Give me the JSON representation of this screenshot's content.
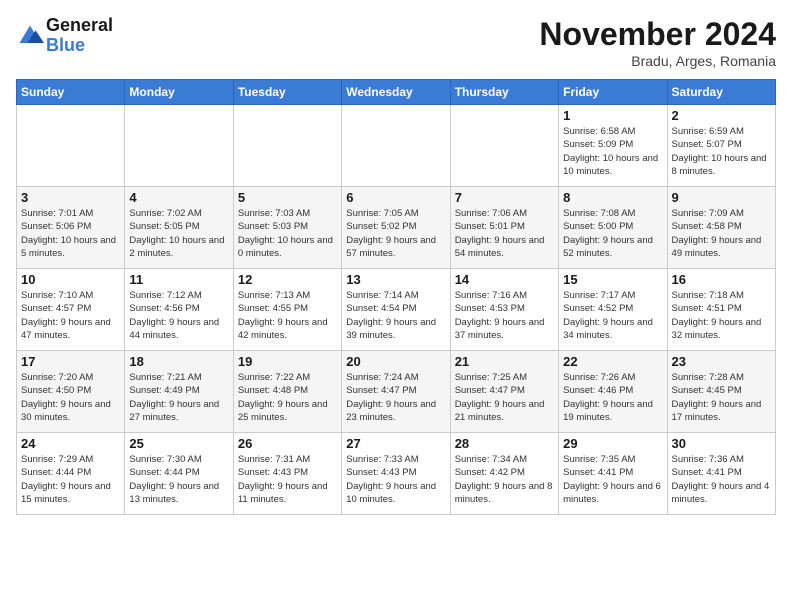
{
  "logo": {
    "text_general": "General",
    "text_blue": "Blue"
  },
  "title": "November 2024",
  "location": "Bradu, Arges, Romania",
  "days_of_week": [
    "Sunday",
    "Monday",
    "Tuesday",
    "Wednesday",
    "Thursday",
    "Friday",
    "Saturday"
  ],
  "weeks": [
    [
      {
        "day": "",
        "info": ""
      },
      {
        "day": "",
        "info": ""
      },
      {
        "day": "",
        "info": ""
      },
      {
        "day": "",
        "info": ""
      },
      {
        "day": "",
        "info": ""
      },
      {
        "day": "1",
        "info": "Sunrise: 6:58 AM\nSunset: 5:09 PM\nDaylight: 10 hours and 10 minutes."
      },
      {
        "day": "2",
        "info": "Sunrise: 6:59 AM\nSunset: 5:07 PM\nDaylight: 10 hours and 8 minutes."
      }
    ],
    [
      {
        "day": "3",
        "info": "Sunrise: 7:01 AM\nSunset: 5:06 PM\nDaylight: 10 hours and 5 minutes."
      },
      {
        "day": "4",
        "info": "Sunrise: 7:02 AM\nSunset: 5:05 PM\nDaylight: 10 hours and 2 minutes."
      },
      {
        "day": "5",
        "info": "Sunrise: 7:03 AM\nSunset: 5:03 PM\nDaylight: 10 hours and 0 minutes."
      },
      {
        "day": "6",
        "info": "Sunrise: 7:05 AM\nSunset: 5:02 PM\nDaylight: 9 hours and 57 minutes."
      },
      {
        "day": "7",
        "info": "Sunrise: 7:06 AM\nSunset: 5:01 PM\nDaylight: 9 hours and 54 minutes."
      },
      {
        "day": "8",
        "info": "Sunrise: 7:08 AM\nSunset: 5:00 PM\nDaylight: 9 hours and 52 minutes."
      },
      {
        "day": "9",
        "info": "Sunrise: 7:09 AM\nSunset: 4:58 PM\nDaylight: 9 hours and 49 minutes."
      }
    ],
    [
      {
        "day": "10",
        "info": "Sunrise: 7:10 AM\nSunset: 4:57 PM\nDaylight: 9 hours and 47 minutes."
      },
      {
        "day": "11",
        "info": "Sunrise: 7:12 AM\nSunset: 4:56 PM\nDaylight: 9 hours and 44 minutes."
      },
      {
        "day": "12",
        "info": "Sunrise: 7:13 AM\nSunset: 4:55 PM\nDaylight: 9 hours and 42 minutes."
      },
      {
        "day": "13",
        "info": "Sunrise: 7:14 AM\nSunset: 4:54 PM\nDaylight: 9 hours and 39 minutes."
      },
      {
        "day": "14",
        "info": "Sunrise: 7:16 AM\nSunset: 4:53 PM\nDaylight: 9 hours and 37 minutes."
      },
      {
        "day": "15",
        "info": "Sunrise: 7:17 AM\nSunset: 4:52 PM\nDaylight: 9 hours and 34 minutes."
      },
      {
        "day": "16",
        "info": "Sunrise: 7:18 AM\nSunset: 4:51 PM\nDaylight: 9 hours and 32 minutes."
      }
    ],
    [
      {
        "day": "17",
        "info": "Sunrise: 7:20 AM\nSunset: 4:50 PM\nDaylight: 9 hours and 30 minutes."
      },
      {
        "day": "18",
        "info": "Sunrise: 7:21 AM\nSunset: 4:49 PM\nDaylight: 9 hours and 27 minutes."
      },
      {
        "day": "19",
        "info": "Sunrise: 7:22 AM\nSunset: 4:48 PM\nDaylight: 9 hours and 25 minutes."
      },
      {
        "day": "20",
        "info": "Sunrise: 7:24 AM\nSunset: 4:47 PM\nDaylight: 9 hours and 23 minutes."
      },
      {
        "day": "21",
        "info": "Sunrise: 7:25 AM\nSunset: 4:47 PM\nDaylight: 9 hours and 21 minutes."
      },
      {
        "day": "22",
        "info": "Sunrise: 7:26 AM\nSunset: 4:46 PM\nDaylight: 9 hours and 19 minutes."
      },
      {
        "day": "23",
        "info": "Sunrise: 7:28 AM\nSunset: 4:45 PM\nDaylight: 9 hours and 17 minutes."
      }
    ],
    [
      {
        "day": "24",
        "info": "Sunrise: 7:29 AM\nSunset: 4:44 PM\nDaylight: 9 hours and 15 minutes."
      },
      {
        "day": "25",
        "info": "Sunrise: 7:30 AM\nSunset: 4:44 PM\nDaylight: 9 hours and 13 minutes."
      },
      {
        "day": "26",
        "info": "Sunrise: 7:31 AM\nSunset: 4:43 PM\nDaylight: 9 hours and 11 minutes."
      },
      {
        "day": "27",
        "info": "Sunrise: 7:33 AM\nSunset: 4:43 PM\nDaylight: 9 hours and 10 minutes."
      },
      {
        "day": "28",
        "info": "Sunrise: 7:34 AM\nSunset: 4:42 PM\nDaylight: 9 hours and 8 minutes."
      },
      {
        "day": "29",
        "info": "Sunrise: 7:35 AM\nSunset: 4:41 PM\nDaylight: 9 hours and 6 minutes."
      },
      {
        "day": "30",
        "info": "Sunrise: 7:36 AM\nSunset: 4:41 PM\nDaylight: 9 hours and 4 minutes."
      }
    ]
  ]
}
